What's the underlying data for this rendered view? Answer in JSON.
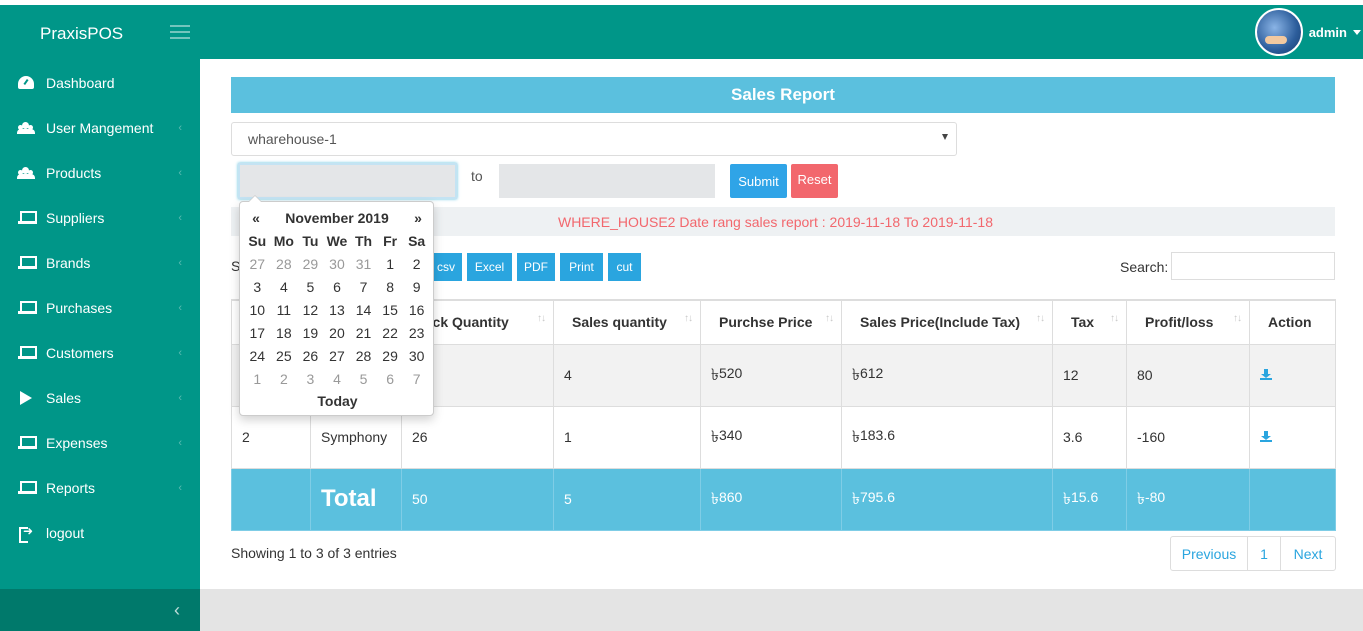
{
  "app": {
    "brand": "PraxisPOS",
    "user": "admin"
  },
  "sidebar": {
    "items": [
      {
        "label": "Dashboard",
        "icon": "dashboard-icon",
        "chevron": false
      },
      {
        "label": "User Mangement",
        "icon": "users-icon",
        "chevron": true
      },
      {
        "label": "Products",
        "icon": "users-icon",
        "chevron": true
      },
      {
        "label": "Suppliers",
        "icon": "laptop-icon",
        "chevron": true
      },
      {
        "label": "Brands",
        "icon": "laptop-icon",
        "chevron": true
      },
      {
        "label": "Purchases",
        "icon": "laptop-icon",
        "chevron": true
      },
      {
        "label": "Customers",
        "icon": "laptop-icon",
        "chevron": true
      },
      {
        "label": "Sales",
        "icon": "play-icon",
        "chevron": true
      },
      {
        "label": "Expenses",
        "icon": "laptop-icon",
        "chevron": true
      },
      {
        "label": "Reports",
        "icon": "laptop-icon",
        "chevron": true
      },
      {
        "label": "logout",
        "icon": "logout-icon",
        "chevron": false
      }
    ],
    "chevron_glyph": "‹",
    "collapse_glyph": "‹"
  },
  "report": {
    "title": "Sales Report",
    "warehouse_selected": "wharehouse-1",
    "date_from_value": "",
    "to_label": "to",
    "date_to_value": "",
    "submit_label": "Submit",
    "reset_label": "Reset",
    "info": "WHERE_HOUSE2 Date rang sales report : 2019-11-18 To 2019-11-18",
    "show_prefix": "S"
  },
  "export_buttons": [
    "csv",
    "Excel",
    "PDF",
    "Print",
    "cut"
  ],
  "search": {
    "label": "Search:",
    "value": ""
  },
  "table": {
    "headers": [
      "",
      "",
      "ock Quantity",
      "Sales quantity",
      "Purchse Price",
      "Sales Price(Include Tax)",
      "Tax",
      "Profit/loss",
      "Action"
    ],
    "rows": [
      {
        "no": "",
        "brand": "",
        "stock": "",
        "sales_qty": "4",
        "purchase": "520",
        "sales_price": "612",
        "tax": "12",
        "profit": "80"
      },
      {
        "no": "2",
        "brand": "Symphony",
        "stock": "26",
        "sales_qty": "1",
        "purchase": "340",
        "sales_price": "183.6",
        "tax": "3.6",
        "profit": "-160"
      }
    ],
    "total": {
      "label": "Total",
      "stock": "50",
      "sales_qty": "5",
      "purchase": "860",
      "sales_price": "795.6",
      "tax": "15.6",
      "profit": "-80"
    },
    "currency": "৳"
  },
  "footer": {
    "showing": "Showing 1 to 3 of 3 entries",
    "previous": "Previous",
    "page": "1",
    "next": "Next"
  },
  "calendar": {
    "month": "November 2019",
    "prev": "«",
    "next": "»",
    "dow": [
      "Su",
      "Mo",
      "Tu",
      "We",
      "Th",
      "Fr",
      "Sa"
    ],
    "weeks": [
      [
        "27",
        "28",
        "29",
        "30",
        "31",
        "1",
        "2"
      ],
      [
        "3",
        "4",
        "5",
        "6",
        "7",
        "8",
        "9"
      ],
      [
        "10",
        "11",
        "12",
        "13",
        "14",
        "15",
        "16"
      ],
      [
        "17",
        "18",
        "19",
        "20",
        "21",
        "22",
        "23"
      ],
      [
        "24",
        "25",
        "26",
        "27",
        "28",
        "29",
        "30"
      ],
      [
        "1",
        "2",
        "3",
        "4",
        "5",
        "6",
        "7"
      ]
    ],
    "today": "Today"
  },
  "colors": {
    "primary": "#009688",
    "sidebar_footer": "#00796b",
    "info": "#5bc0de",
    "button_blue": "#2aa5df",
    "reset_red": "#f2676d"
  }
}
